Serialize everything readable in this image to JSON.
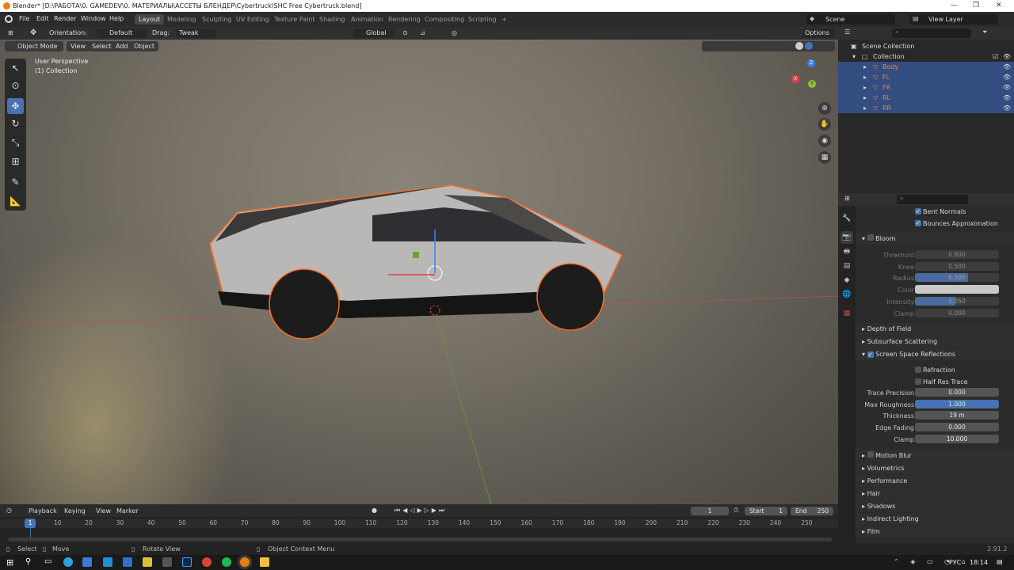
{
  "window": {
    "title": "Blender* [D:\\РАБОТА\\0. GAMEDEV\\0. МАТЕРИАЛЫ\\АССЕТЫ БЛЕНДЕР\\Cybertruck\\SHC Free Cybertruck.blend]",
    "minimize": "—",
    "maximize": "❐",
    "close": "✕"
  },
  "menus": [
    "File",
    "Edit",
    "Render",
    "Window",
    "Help"
  ],
  "workspaces": [
    "Layout",
    "Modeling",
    "Sculpting",
    "UV Editing",
    "Texture Paint",
    "Shading",
    "Animation",
    "Rendering",
    "Compositing",
    "Scripting"
  ],
  "workspace_add": "+",
  "scene": {
    "name": "Scene",
    "view_layer": "View Layer"
  },
  "tool_header": {
    "orientation_label": "Orientation:",
    "orientation": "Default",
    "drag_label": "Drag:",
    "drag": "Tweak",
    "transform": "Global",
    "options": "Options"
  },
  "viewport": {
    "mode": "Object Mode",
    "menus": [
      "View",
      "Select",
      "Add",
      "Object"
    ],
    "perspective": "User Perspective",
    "collection": "(1) Collection",
    "gizmo": {
      "x": "X",
      "y": "Y",
      "z": "Z"
    }
  },
  "outliner": {
    "root": "Scene Collection",
    "collection": "Collection",
    "objects": [
      "Body",
      "FL",
      "FR",
      "RL",
      "RR"
    ]
  },
  "props": {
    "bent_normals": "Bent Normals",
    "bounces": "Bounces Approximation",
    "bloom": {
      "title": "Bloom",
      "threshold_l": "Threshold",
      "threshold": "0.800",
      "knee_l": "Knee",
      "knee": "0.500",
      "radius_l": "Radius",
      "radius": "6.500",
      "color_l": "Color",
      "intensity_l": "Intensity",
      "intensity": "0.050",
      "clamp_l": "Clamp",
      "clamp": "0.000"
    },
    "dof": "Depth of Field",
    "sss": "Subsurface Scattering",
    "ssr": "Screen Space Reflections",
    "refraction": "Refraction",
    "half_res": "Half Res Trace",
    "trace_precision_l": "Trace Precision",
    "trace_precision": "0.000",
    "max_rough_l": "Max Roughness",
    "max_rough": "1.000",
    "thickness_l": "Thickness",
    "thickness": "19 m",
    "edge_fading_l": "Edge Fading",
    "edge_fading": "0.000",
    "clamp_l": "Clamp",
    "clamp": "10.000",
    "panels": [
      "Motion Blur",
      "Volumetrics",
      "Performance",
      "Hair",
      "Shadows",
      "Indirect Lighting",
      "Film"
    ]
  },
  "timeline": {
    "menus": [
      "Playback",
      "Keying",
      "View",
      "Marker"
    ],
    "frame": "1",
    "start_l": "Start",
    "start": "1",
    "end_l": "End",
    "end": "250",
    "ticks": [
      "1",
      "10",
      "20",
      "30",
      "40",
      "50",
      "60",
      "70",
      "80",
      "90",
      "100",
      "110",
      "120",
      "130",
      "140",
      "150",
      "160",
      "170",
      "180",
      "190",
      "200",
      "210",
      "220",
      "230",
      "240",
      "250"
    ],
    "current_frame_position": 0.0
  },
  "status": {
    "select": "Select",
    "move": "Move",
    "rotate": "Rotate View",
    "context": "Object Context Menu",
    "version": "2.91.2"
  },
  "taskbar": {
    "lang": "РУС",
    "time": "18:14"
  },
  "colors": {
    "accent": "#4772b3",
    "selection_outline": "#ff6a20",
    "x_axis": "#e04050",
    "y_axis": "#80c030",
    "z_axis": "#3080ff"
  }
}
